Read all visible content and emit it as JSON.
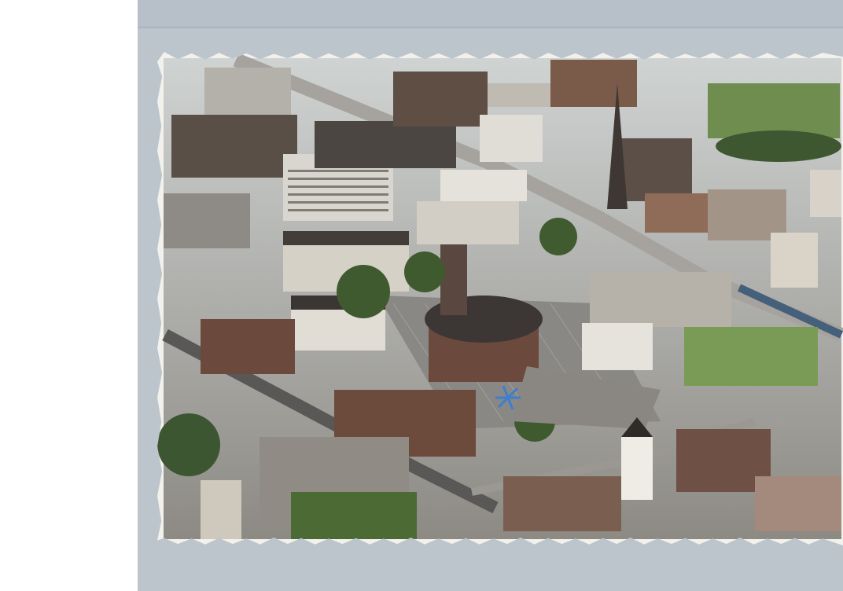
{
  "scene": {
    "subject": "aerial-city-postcard",
    "palette": {
      "margin": "#ffffff",
      "scan_bed": "#bcc4cc",
      "card_border": "#f3f1ec",
      "roofs_dark": "#3b3836",
      "roofs_brown": "#6d4a3a",
      "facade_light": "#d9d4c9",
      "plaza": "#8c8a86",
      "grass": "#6f8f4a",
      "trees": "#3f5a2e",
      "roads": "#9a9792",
      "church_dome": "#4a4442",
      "accent_blue": "#3c7fd0"
    }
  }
}
